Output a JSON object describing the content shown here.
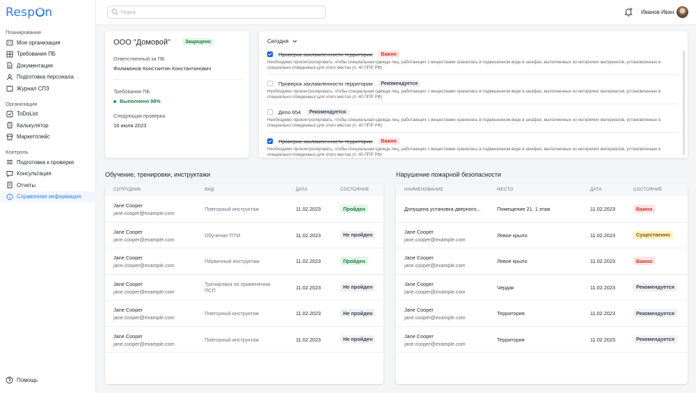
{
  "app": {
    "logo_text_1": "Resp",
    "logo_text_2": "n"
  },
  "sidebar": {
    "sections": [
      {
        "title": "Планирование",
        "items": [
          "Моя организация",
          "Требования ПБ",
          "Документация",
          "Подготовка персонала",
          "Журнал СПЗ"
        ]
      },
      {
        "title": "Организация",
        "items": [
          "ToDoList",
          "Калькулятор",
          "Маркетплейс"
        ]
      },
      {
        "title": "Контроль",
        "items": [
          "Подготовка к проверке",
          "Консультация",
          "Отчеты",
          "Справочная информация"
        ]
      }
    ],
    "help_label": "Помощь"
  },
  "header": {
    "search_placeholder": "Поиск",
    "user_name": "Иванов Иван"
  },
  "org": {
    "title": "ООО \"Домовой\"",
    "badge": "Защищено",
    "responsible_label": "Ответственный за ПБ",
    "responsible_name": "Филимонов Константин Константинович",
    "requirements_label": "Требования ПБ",
    "requirements_status": "Выполнено 98%",
    "next_check_label": "Следующая проверка",
    "next_check_date": "16 июля 2023"
  },
  "today": {
    "filter_label": "Сегодня",
    "tasks": [
      {
        "title": "Проверка захламленности территории",
        "badge": "Важно",
        "badge_type": "red",
        "checked": true,
        "desc": "Необходимо проконтролировать, чтобы специальная одежда лиц, работающих с веществами хранилась в подвешенном виде в шкафах, выполненных из негорючих материалов, установленных в специально отведенных для этого местах (п. 40 ППР РФ)"
      },
      {
        "title": "Проверка захламленности территории",
        "badge": "Рекомендуется",
        "badge_type": "gray",
        "checked": false,
        "desc": "Необходимо проконтролировать, чтобы специальная одежда лиц, работающих с веществами хранилась в подвешенном виде в шкафах, выполненных из негорючих материалов, установленных в специально отведенных для этого местах (п. 40 ППР РФ)"
      },
      {
        "title": "Дело 654",
        "badge": "Рекомендуется",
        "badge_type": "gray",
        "checked": false,
        "desc": "Необходимо проконтролировать, чтобы специальная одежда лиц, работающих с веществами хранилась в подвешенном виде в шкафах, выполненных из негорючих материалов, установленных в специально отведенных для этого местах (п. 40 ППР РФ)"
      },
      {
        "title": "Проверка захламленности территории",
        "badge": "Важно",
        "badge_type": "red",
        "checked": true,
        "desc": "Необходимо проконтролировать, чтобы специальная одежда лиц, работающих с веществами хранилась в подвешенном виде в шкафах, выполненных из негорючих материалов, установленных в специально отведенных для этого местах (п. 40 ППР РФ)"
      }
    ]
  },
  "training": {
    "title": "Обучение, тренировки, инструктажи",
    "headers": [
      "Сотрудник",
      "Вид",
      "Дата",
      "Состояние"
    ],
    "rows": [
      {
        "name": "Jane Cooper",
        "email": "jane.cooper@example.com",
        "type": "Повторный инструктаж",
        "date": "11.02.2023",
        "status": "Пройден",
        "status_type": "green"
      },
      {
        "name": "Jane Cooper",
        "email": "jane.cooper@example.com",
        "type": "Обучение ПТМ",
        "date": "11.02.2023",
        "status": "Не пройден",
        "status_type": "gray"
      },
      {
        "name": "Jane Cooper",
        "email": "jane.cooper@example.com",
        "type": "Первичный инструктаж",
        "date": "11.02.2023",
        "status": "Пройден",
        "status_type": "green"
      },
      {
        "name": "Jane Cooper",
        "email": "jane.cooper@example.com",
        "type": "Тренировка по применению ПСП",
        "date": "11.02.2023",
        "status": "Не пройден",
        "status_type": "gray"
      },
      {
        "name": "Jane Cooper",
        "email": "jane.cooper@example.com",
        "type": "Повторный инструктаж",
        "date": "11.02.2023",
        "status": "Не пройден",
        "status_type": "gray"
      },
      {
        "name": "Jane Cooper",
        "email": "jane.cooper@example.com",
        "type": "Повторный инструктаж",
        "date": "11.02.2023",
        "status": "Не пройден",
        "status_type": "gray"
      }
    ]
  },
  "violations": {
    "title": "Нарушение пожарной безопасности",
    "headers": [
      "Наименование",
      "Место",
      "Дата",
      "Состояние"
    ],
    "rows": [
      {
        "name": "Допущена установка дверного...",
        "email": "",
        "place": "Помещение 21, 1 этаж",
        "date": "11.02.2023",
        "status": "Важно",
        "status_type": "red"
      },
      {
        "name": "Jane Cooper",
        "email": "jane.cooper@example.com",
        "place": "Левое крыло",
        "date": "11.02.2023",
        "status": "Существенно",
        "status_type": "yellow"
      },
      {
        "name": "Jane Cooper",
        "email": "jane.cooper@example.com",
        "place": "Левое крыло",
        "date": "11.02.2023",
        "status": "Важно",
        "status_type": "red"
      },
      {
        "name": "Jane Cooper",
        "email": "jane.cooper@example.com",
        "place": "Чердак",
        "date": "11.02.2023",
        "status": "Рекомендуется",
        "status_type": "gray"
      },
      {
        "name": "Jane Cooper",
        "email": "jane.cooper@example.com",
        "place": "Территория",
        "date": "11.02.2023",
        "status": "Рекомендуется",
        "status_type": "gray"
      },
      {
        "name": "Jane Cooper",
        "email": "jane.cooper@example.com",
        "place": "Территория",
        "date": "11.02.2023",
        "status": "Рекомендуется",
        "status_type": "gray"
      }
    ]
  },
  "colors": {
    "accent": "#2c7be5",
    "checkbox": "#1f5ed8",
    "success": "#1d7a43",
    "danger": "#c8342d"
  }
}
